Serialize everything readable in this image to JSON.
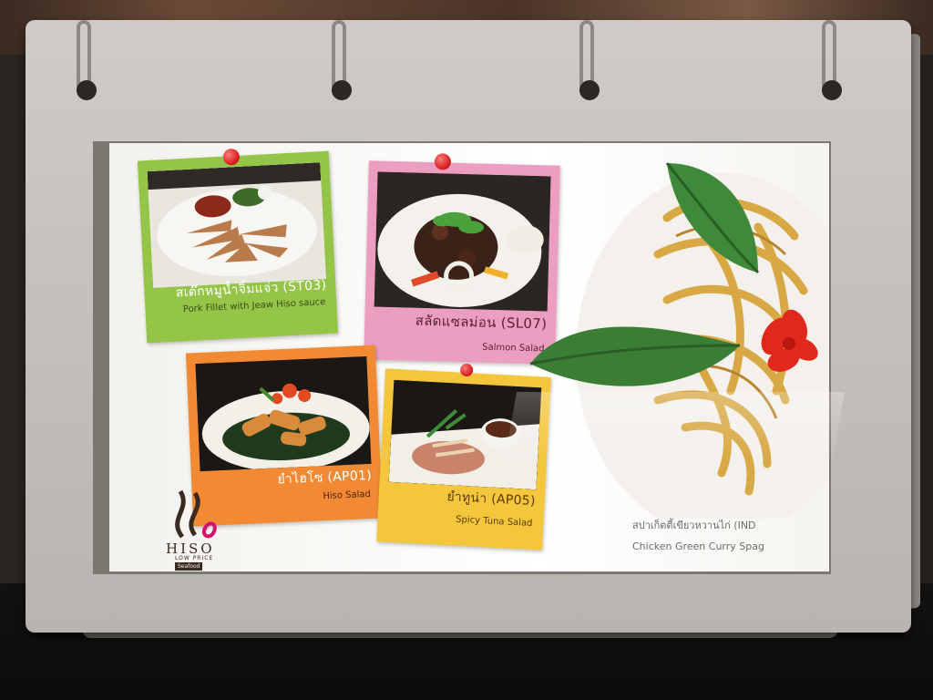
{
  "menu": {
    "items": [
      {
        "thai": "สเต๊กหมูน้ำจิ้มแจ่ว (ST03)",
        "english": "Pork Fillet with Jeaw Hiso sauce"
      },
      {
        "thai": "สลัดแซลม่อน (SL07)",
        "english": "Salmon Salad"
      },
      {
        "thai": "ยำไฮโซ (AP01)",
        "english": "Hiso Salad"
      },
      {
        "thai": "ยำทูน่า (AP05)",
        "english": "Spicy Tuna Salad"
      }
    ],
    "featured": {
      "thai": "สปาเก็ตตี้เขียวหวานไก่ (IND",
      "english": "Chicken Green Curry Spag"
    }
  },
  "logo": {
    "name": "HISO",
    "subtitle": "LOW PRICE",
    "tag": "Seafood"
  },
  "colors": {
    "green_card": "#95c548",
    "pink_card": "#ec9ec0",
    "orange_card": "#f28a34",
    "yellow_card": "#f4c63c",
    "pin": "#d01818"
  }
}
